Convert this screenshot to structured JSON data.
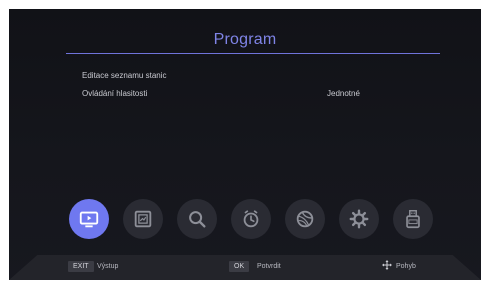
{
  "header": {
    "title": "Program"
  },
  "menu": {
    "items": [
      {
        "label": "Editace seznamu stanic",
        "value": ""
      },
      {
        "label": "Ovládání hlasitosti",
        "value": "Jednotné"
      }
    ]
  },
  "icon_bar": {
    "items": [
      {
        "icon": "tv-icon",
        "active": true
      },
      {
        "icon": "picture-icon",
        "active": false
      },
      {
        "icon": "search-icon",
        "active": false
      },
      {
        "icon": "timer-icon",
        "active": false
      },
      {
        "icon": "network-icon",
        "active": false
      },
      {
        "icon": "gear-icon",
        "active": false
      },
      {
        "icon": "usb-icon",
        "active": false
      }
    ]
  },
  "footer": {
    "exit_key": "EXIT",
    "exit_label": "Výstup",
    "ok_key": "OK",
    "ok_label": "Potvrdit",
    "move_label": "Pohyb"
  },
  "colors": {
    "accent": "#6f78f0",
    "title": "#7f84e6",
    "background": "#131419",
    "icon_circle": "#2a2b33"
  }
}
